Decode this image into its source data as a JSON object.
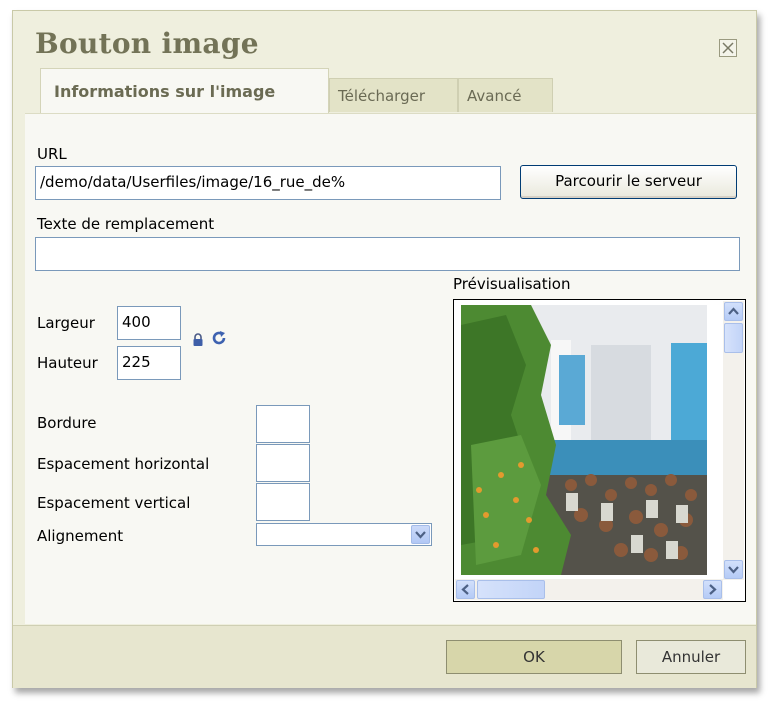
{
  "dialog": {
    "title": "Bouton image",
    "close_icon": "close-icon"
  },
  "tabs": [
    {
      "label": "Informations sur l'image",
      "active": true
    },
    {
      "label": "Télécharger",
      "active": false
    },
    {
      "label": "Avancé",
      "active": false
    }
  ],
  "form": {
    "url_label": "URL",
    "url_value": "/demo/data/Userfiles/image/16_rue_de%",
    "browse_button": "Parcourir le serveur",
    "alt_label": "Texte de remplacement",
    "alt_value": "",
    "width_label": "Largeur",
    "width_value": "400",
    "height_label": "Hauteur",
    "height_value": "225",
    "lock_icon": "lock-icon",
    "reset_icon": "reset-size-icon",
    "border_label": "Bordure",
    "border_value": "",
    "hspace_label": "Espacement horizontal",
    "hspace_value": "",
    "vspace_label": "Espacement vertical",
    "vspace_value": "",
    "align_label": "Alignement",
    "align_value": ""
  },
  "preview": {
    "label": "Prévisualisation"
  },
  "footer": {
    "ok_button": "OK",
    "cancel_button": "Annuler"
  },
  "colors": {
    "dialog_bg": "#efefde",
    "panel_bg": "#f8f8f3",
    "title": "#737357",
    "input_border": "#7a99ba"
  }
}
